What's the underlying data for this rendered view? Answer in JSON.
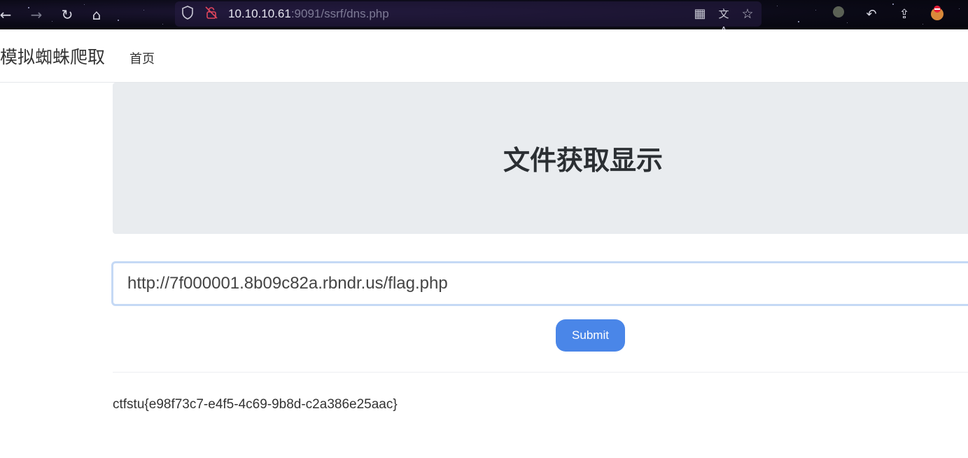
{
  "browser": {
    "url_host": "10.10.10.61",
    "url_rest": ":9091/ssrf/dns.php",
    "icons": {
      "back": "back-arrow-icon",
      "forward": "forward-arrow-icon",
      "reload": "reload-icon",
      "home": "home-icon",
      "shield": "shield-icon",
      "insecure": "insecure-lock-icon",
      "qr": "qr-code-icon",
      "translate": "translate-icon",
      "bookmark": "star-icon",
      "extension": "extension-icon",
      "undo": "undo-icon",
      "share": "share-icon",
      "profile": "profile-icon"
    }
  },
  "navbar": {
    "brand": "模拟蜘蛛爬取",
    "home_link": "首页"
  },
  "hero": {
    "title": "文件获取显示"
  },
  "form": {
    "url_value": "http://7f000001.8b09c82a.rbndr.us/flag.php",
    "submit_label": "Submit"
  },
  "result": {
    "text": "ctfstu{e98f73c7-e4f5-4c69-9b8d-c2a386e25aac}"
  },
  "colors": {
    "submit_bg": "#4a86e8",
    "hero_bg": "#e9ecef",
    "input_border_focus": "#c5d9f5"
  }
}
